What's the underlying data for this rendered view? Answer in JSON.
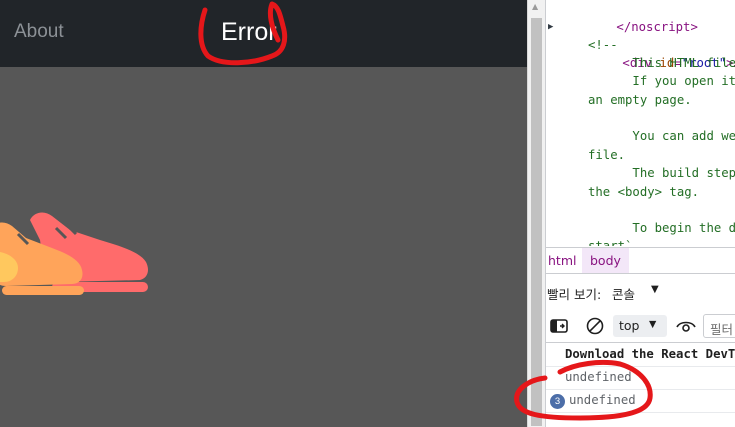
{
  "app": {
    "nav_about": "About",
    "nav_title": "Error",
    "colors": {
      "navbar": "#212529",
      "background": "#575757",
      "shoe_red": "#ff6b6b",
      "shoe_orange": "#ffa45a"
    }
  },
  "elements_panel": {
    "lines": [
      {
        "t0": "</noscript>"
      },
      {
        "t0": "<div ",
        "attr": "id",
        "eq": "=",
        "val": "\"root\"",
        "t1": ">…</di"
      },
      {
        "t0": "<!--"
      },
      {
        "t0": "      This HTML file"
      },
      {
        "t0": "      If you open it"
      },
      {
        "t0": "an empty page."
      },
      {
        "t0": ""
      },
      {
        "t0": "      You can add we"
      },
      {
        "t0": "file."
      },
      {
        "t0": "      The build step"
      },
      {
        "t0": "the <body> tag."
      },
      {
        "t0": ""
      },
      {
        "t0": "      To begin the d"
      },
      {
        "t0": "start`"
      }
    ]
  },
  "breadcrumbs": [
    "html",
    "body"
  ],
  "drawer": {
    "label": "빨리 보기:",
    "tab": "콘솔",
    "caret": "▼"
  },
  "console_toolbar": {
    "context": "top",
    "context_caret": "▼",
    "filter_placeholder": "필터",
    "icons": [
      "sidebar-toggle-icon",
      "clear-console-icon",
      "eye-icon"
    ]
  },
  "console_messages": [
    {
      "text": "Download the React DevTools"
    },
    {
      "text": "undefined"
    },
    {
      "text": "undefined",
      "repeat_count": "3"
    }
  ],
  "annotations": {
    "color": "#e5171a"
  }
}
